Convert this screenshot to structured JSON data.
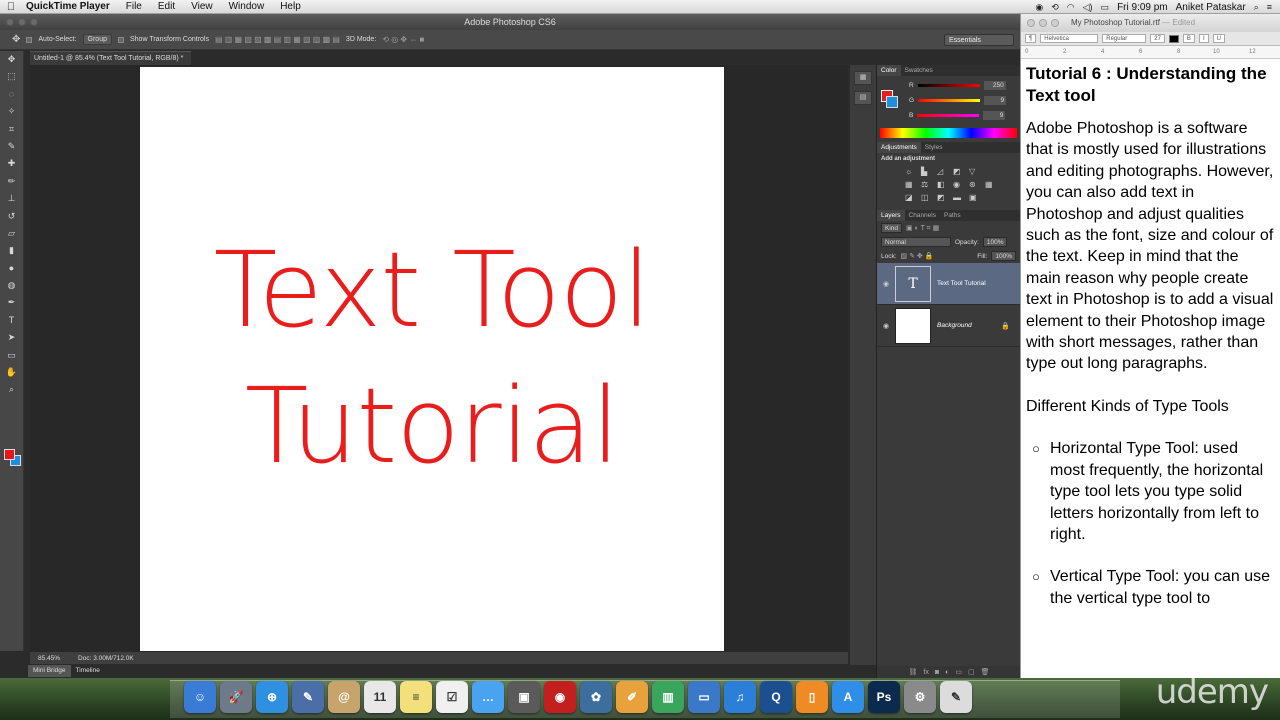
{
  "menubar": {
    "app_name": "QuickTime Player",
    "items": [
      "File",
      "Edit",
      "View",
      "Window",
      "Help"
    ],
    "clock": "Fri 9:09 pm",
    "user": "Aniket Pataskar"
  },
  "photoshop": {
    "title": "Adobe Photoshop CS6",
    "options": {
      "auto_select_label": "Auto-Select:",
      "auto_select_value": "Group",
      "transform_label": "Show Transform Controls",
      "mode_label": "3D Mode:",
      "workspace": "Essentials"
    },
    "doc_tab": "Untitled-1 @ 85.4% (Text Tool  Tutorial, RGB/8) *",
    "canvas_text": {
      "line1": "Text Tool",
      "line2": "Tutorial",
      "color": "#ea1d1d"
    },
    "status": {
      "zoom": "85.45%",
      "doc": "Doc: 3.00M/712.0K"
    },
    "bottom_tabs": [
      "Mini Bridge",
      "Timeline"
    ],
    "color_panel": {
      "tabs": [
        "Color",
        "Swatches"
      ],
      "r_label": "R",
      "r": "250",
      "g_label": "G",
      "g": "9",
      "b_label": "B",
      "b": "9"
    },
    "adjustments": {
      "tabs": [
        "Adjustments",
        "Styles"
      ],
      "title": "Add an adjustment"
    },
    "layers": {
      "tabs": [
        "Layers",
        "Channels",
        "Paths"
      ],
      "kind": "Kind",
      "blend": "Normal",
      "opacity_label": "Opacity:",
      "opacity": "100%",
      "lock_label": "Lock:",
      "fill_label": "Fill:",
      "fill": "100%",
      "items": [
        {
          "name": "Text Tool  Tutorial",
          "thumb": "T"
        },
        {
          "name": "Background",
          "thumb": ""
        }
      ]
    }
  },
  "textedit": {
    "title": "My Photoshop Tutorial.rtf",
    "edited": "— Edited",
    "font": "Helvetica",
    "style": "Regular",
    "size": "27",
    "ruler": [
      "0",
      "2",
      "4",
      "6",
      "8",
      "10",
      "12"
    ],
    "heading": "Tutorial 6 : Understanding the Text tool",
    "para1": "Adobe Photoshop is a software that is mostly used for illustrations and editing photographs. However, you can also add text in Photoshop and adjust qualities such as the font, size and colour of the text. Keep in mind that the main reason why people create text in Photoshop is to add a visual element to their Photoshop image with short messages, rather than type out long paragraphs.",
    "para2": "Different Kinds of Type Tools",
    "bullets": [
      "Horizontal Type Tool: used most frequently, the horizontal type tool lets you type solid letters horizontally from left to right.",
      "Vertical Type Tool: you can use the vertical type tool to"
    ]
  },
  "dock": {
    "apps": [
      {
        "name": "Finder",
        "glyph": "☺",
        "color": "#3a7bd5"
      },
      {
        "name": "Launchpad",
        "glyph": "🚀",
        "color": "#6c7a89"
      },
      {
        "name": "Safari",
        "glyph": "⊕",
        "color": "#2f8fe0"
      },
      {
        "name": "Preview",
        "glyph": "✎",
        "color": "#4a6ea8"
      },
      {
        "name": "Contacts",
        "glyph": "@",
        "color": "#c7a46b"
      },
      {
        "name": "Calendar",
        "glyph": "11",
        "color": "#e8e8e8"
      },
      {
        "name": "Notes",
        "glyph": "≡",
        "color": "#f3e07a"
      },
      {
        "name": "Reminders",
        "glyph": "☑",
        "color": "#f0f0f0"
      },
      {
        "name": "Messages",
        "glyph": "…",
        "color": "#4aa3f0"
      },
      {
        "name": "FaceTime",
        "glyph": "▣",
        "color": "#5a5a5a"
      },
      {
        "name": "Photo Booth",
        "glyph": "◉",
        "color": "#c41f1f"
      },
      {
        "name": "iPhoto",
        "glyph": "✿",
        "color": "#3c6f9e"
      },
      {
        "name": "Pages",
        "glyph": "✐",
        "color": "#e9a23b"
      },
      {
        "name": "Numbers",
        "glyph": "▥",
        "color": "#3aa55d"
      },
      {
        "name": "Keynote",
        "glyph": "▭",
        "color": "#3a78c8"
      },
      {
        "name": "iTunes",
        "glyph": "♫",
        "color": "#2c7fd8"
      },
      {
        "name": "QuickTime",
        "glyph": "Q",
        "color": "#1c4f8f"
      },
      {
        "name": "iBooks",
        "glyph": "▯",
        "color": "#f08a24"
      },
      {
        "name": "App Store",
        "glyph": "A",
        "color": "#2e8ee8"
      },
      {
        "name": "Photoshop",
        "glyph": "Ps",
        "color": "#0b2a4d"
      },
      {
        "name": "System Preferences",
        "glyph": "⚙",
        "color": "#8a8a8a"
      },
      {
        "name": "TextEdit",
        "glyph": "✎",
        "color": "#dcdcdc"
      }
    ],
    "watermark": "udemy"
  }
}
